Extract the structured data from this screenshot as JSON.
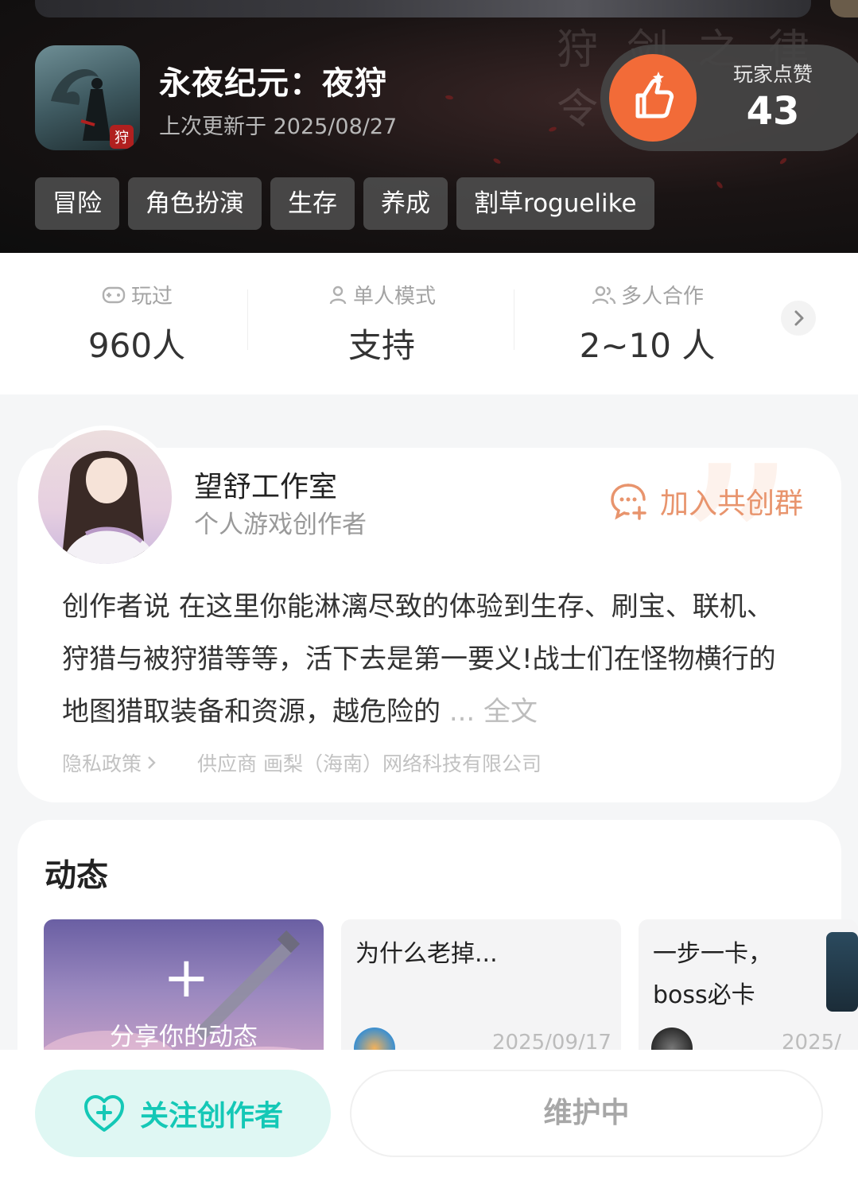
{
  "game": {
    "title": "永夜纪元：夜狩",
    "update_text": "上次更新于 2025/08/27",
    "hero_calligraphy": "狩 剑 之 律 令",
    "icon_badge": "狩"
  },
  "likes": {
    "label": "玩家点赞",
    "count": "43"
  },
  "tags": [
    "冒险",
    "角色扮演",
    "生存",
    "养成",
    "割草roguelike"
  ],
  "stats": {
    "played": {
      "label": "玩过",
      "value": "960人",
      "icon": "gamepad-icon"
    },
    "single": {
      "label": "单人模式",
      "value": "支持",
      "icon": "person-icon"
    },
    "multi": {
      "label": "多人合作",
      "value": "2~10 人",
      "icon": "people-icon"
    }
  },
  "creator": {
    "name": "望舒工作室",
    "role": "个人游戏创作者",
    "join_group": "加入共创群",
    "says_lead": "创作者说",
    "says_text": " 在这里你能淋漓尽致的体验到生存、刷宝、联机、狩猎与被狩猎等等，活下去是第一要义!战士们在怪物横行的地图猎取装备和资源，越危险的",
    "more": "... 全文",
    "privacy": "隐私政策",
    "supplier": "供应商 画梨（海南）网络科技有限公司"
  },
  "activity": {
    "title": "动态",
    "share_label": "分享你的动态",
    "posts": [
      {
        "title": "为什么老掉...",
        "date": "2025/09/17"
      },
      {
        "title": "一步一卡，boss必卡",
        "date": "2025/"
      }
    ]
  },
  "bottom": {
    "follow": "关注创作者",
    "maintenance": "维护中"
  },
  "colors": {
    "accent_orange": "#f26b38",
    "accent_teal": "#14c8b6",
    "group_orange": "#e8946d"
  }
}
